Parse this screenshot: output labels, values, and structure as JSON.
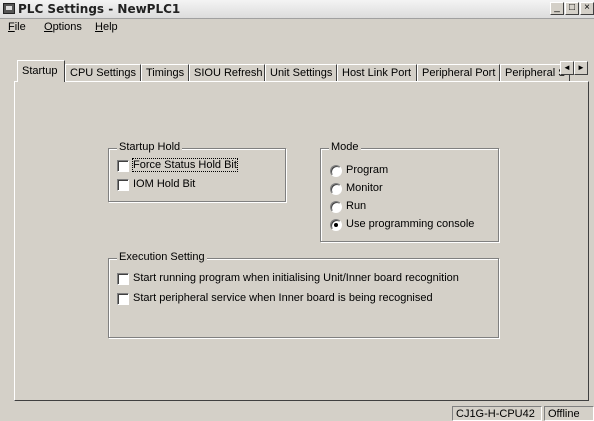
{
  "window": {
    "title": "PLC Settings - NewPLC1",
    "minimize_glyph": "_",
    "maximize_glyph": "□",
    "close_glyph": "×"
  },
  "menu": {
    "items": [
      {
        "label": "File",
        "accel": "F",
        "rest": "ile"
      },
      {
        "label": "Options",
        "accel": "O",
        "rest": "ptions"
      },
      {
        "label": "Help",
        "accel": "H",
        "rest": "elp"
      }
    ]
  },
  "tabs": [
    {
      "label": "Startup",
      "active": true
    },
    {
      "label": "CPU Settings",
      "active": false
    },
    {
      "label": "Timings",
      "active": false
    },
    {
      "label": "SIOU Refresh",
      "active": false
    },
    {
      "label": "Unit Settings",
      "active": false
    },
    {
      "label": "Host Link Port",
      "active": false
    },
    {
      "label": "Peripheral Port",
      "active": false
    },
    {
      "label": "Peripheral S",
      "active": false
    }
  ],
  "tab_scroll": {
    "left_glyph": "◄",
    "right_glyph": "►"
  },
  "startup_hold": {
    "title": "Startup Hold",
    "options": [
      {
        "label": "Force Status Hold Bit",
        "checked": false
      },
      {
        "label": "IOM Hold Bit",
        "checked": false
      }
    ]
  },
  "mode": {
    "title": "Mode",
    "options": [
      {
        "label": "Program",
        "selected": false
      },
      {
        "label": "Monitor",
        "selected": false
      },
      {
        "label": "Run",
        "selected": false
      },
      {
        "label": "Use programming console",
        "selected": true
      }
    ]
  },
  "execution_setting": {
    "title": "Execution Setting",
    "options": [
      {
        "label": "Start running program when initialising Unit/Inner board recognition",
        "checked": false
      },
      {
        "label": "Start peripheral service when Inner board is being recognised",
        "checked": false
      }
    ]
  },
  "status": {
    "device": "CJ1G-H-CPU42",
    "connection": "Offline"
  },
  "icons": {
    "app": "plc-app-icon"
  }
}
